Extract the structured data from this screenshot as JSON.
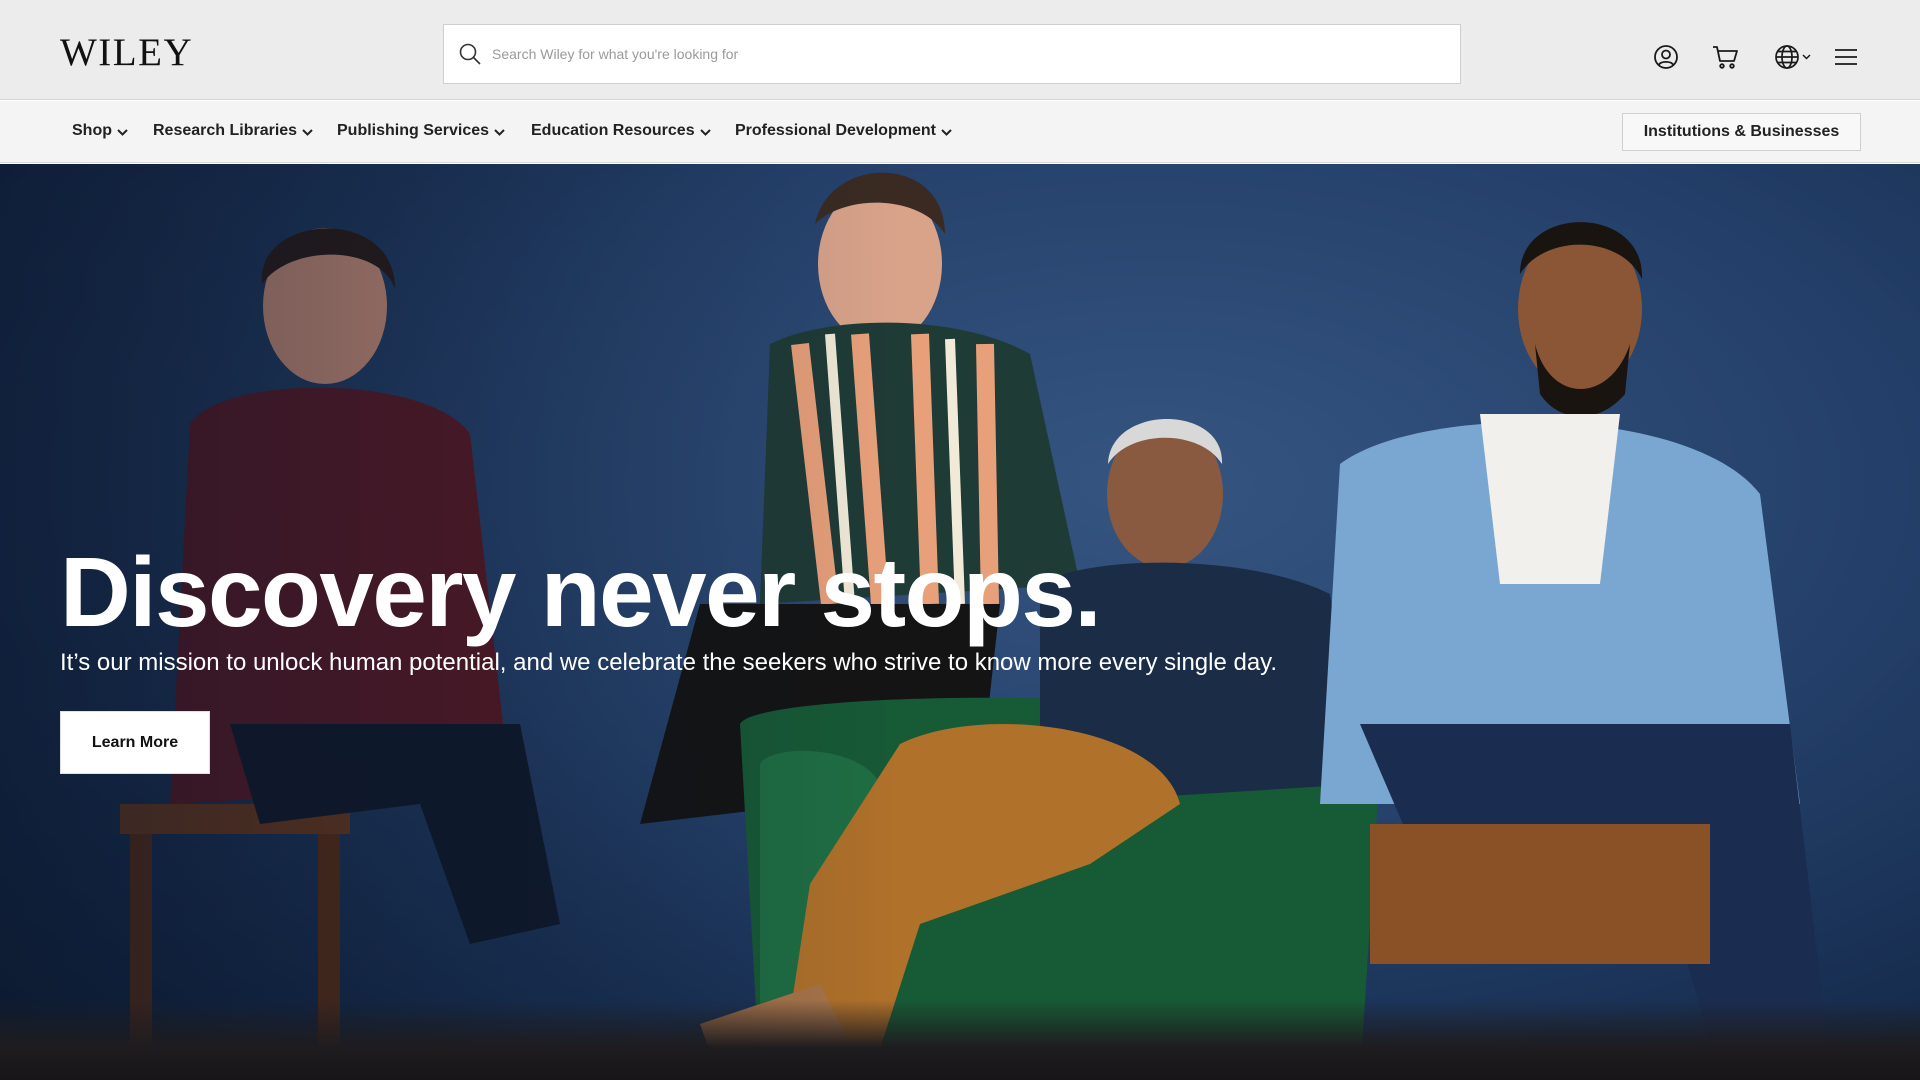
{
  "header": {
    "logo": "WILEY",
    "search_placeholder": "Search Wiley for what you're looking for",
    "icons": [
      "search-icon",
      "account-icon",
      "cart-icon",
      "globe-icon",
      "chevron-down-icon",
      "hamburger-menu-icon"
    ]
  },
  "nav": {
    "items": [
      {
        "label": "Shop"
      },
      {
        "label": "Research Libraries"
      },
      {
        "label": "Publishing Services"
      },
      {
        "label": "Education Resources"
      },
      {
        "label": "Professional Development"
      }
    ],
    "cta": "Institutions & Businesses"
  },
  "hero": {
    "title": "Discovery never stops.",
    "subtitle": "It’s our mission to unlock human potential, and we celebrate the seekers who strive to know more every single day.",
    "button": "Learn More",
    "background_colors": {
      "wall": "#24406a",
      "chair": "#1d5a3a",
      "trousers": "#b0712a"
    }
  }
}
